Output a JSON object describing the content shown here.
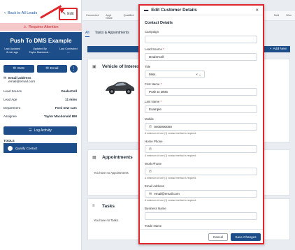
{
  "left": {
    "back_label": "Back to All Leads",
    "edit_label": "Edit",
    "required_label": "Requires Attention",
    "lead_name": "Push To DMS Example",
    "meta": [
      {
        "label": "Last Updated",
        "value": "8 min ago"
      },
      {
        "label": "Updated By",
        "value": "Taylor Macdonal..."
      },
      {
        "label": "Last Contacted",
        "value": "---"
      }
    ],
    "sms_label": "SMS",
    "email_btn_label": "Email",
    "email_heading": "Email address",
    "email_value": "email@email.com",
    "fields": [
      {
        "key": "Lead Source",
        "value": "DealerCell"
      },
      {
        "key": "Lead Age",
        "value": "11 mins"
      },
      {
        "key": "Department",
        "value": "Ford new cars"
      },
      {
        "key": "Assignee",
        "value": "Taylor Macdonald BM"
      }
    ],
    "log_activity_label": "Log Activity",
    "tools_label": "TOOLS",
    "tool_item": "Qualify Contact"
  },
  "top_tabs": [
    "Connected",
    "Appt Made",
    "Qualified",
    "Sold",
    "Won"
  ],
  "main": {
    "subtabs": [
      "All",
      "Tasks & Appointments"
    ],
    "add_new": "Add New",
    "vehicle_title": "Vehicle of Interest",
    "appointments_title": "Appointments",
    "appointments_empty": "You have no Appointments",
    "tasks_title": "Tasks",
    "tasks_empty": "You have no Tasks."
  },
  "modal": {
    "title": "Edit Customer Details",
    "section": "Contact Details",
    "campaign_label": "Campaign",
    "lead_source_label": "Lead Source",
    "lead_source_value": "DealerCell",
    "title_label": "Title",
    "title_value": "Miss.",
    "first_name_label": "First Name",
    "first_name_value": "Push to DMS",
    "last_name_label": "Last Name",
    "last_name_value": "Example",
    "mobile_label": "Mobile",
    "mobile_value": "0400000000",
    "hint": "A minimum of one (1) contact method is required.",
    "home_phone_label": "Home Phone",
    "work_phone_label": "Work Phone",
    "email_label": "Email Address",
    "email_value": "email@email.com",
    "business_label": "Business Name",
    "trade_label": "Trade Name",
    "cancel_label": "Cancel",
    "save_label": "Save Changes"
  }
}
